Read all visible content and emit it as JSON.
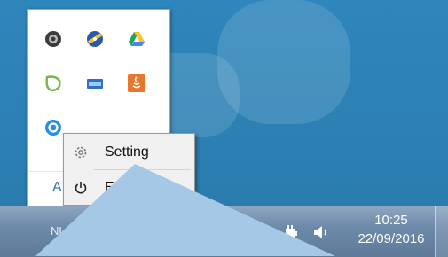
{
  "taskbar": {
    "language": "NL",
    "clock_time": "10:25",
    "clock_date": "22/09/2016"
  },
  "tray_popup": {
    "customize_partial": "A"
  },
  "context_menu": {
    "setting_label": "Setting",
    "exit_partial": "E"
  },
  "colors": {
    "desktop": "#2f82b8",
    "callout": "#9fc6e6"
  },
  "icons": {
    "tray": [
      "steam-icon",
      "disc-icon",
      "google-drive-icon",
      "leaf-icon",
      "network-card-icon",
      "java-icon",
      "blue-app-icon"
    ],
    "taskbar": [
      "show-hidden-icons-icon",
      "update-icon",
      "signal-icon",
      "sync-check-icon",
      "tablet-icon",
      "flag-icon",
      "power-icon",
      "volume-icon"
    ]
  }
}
